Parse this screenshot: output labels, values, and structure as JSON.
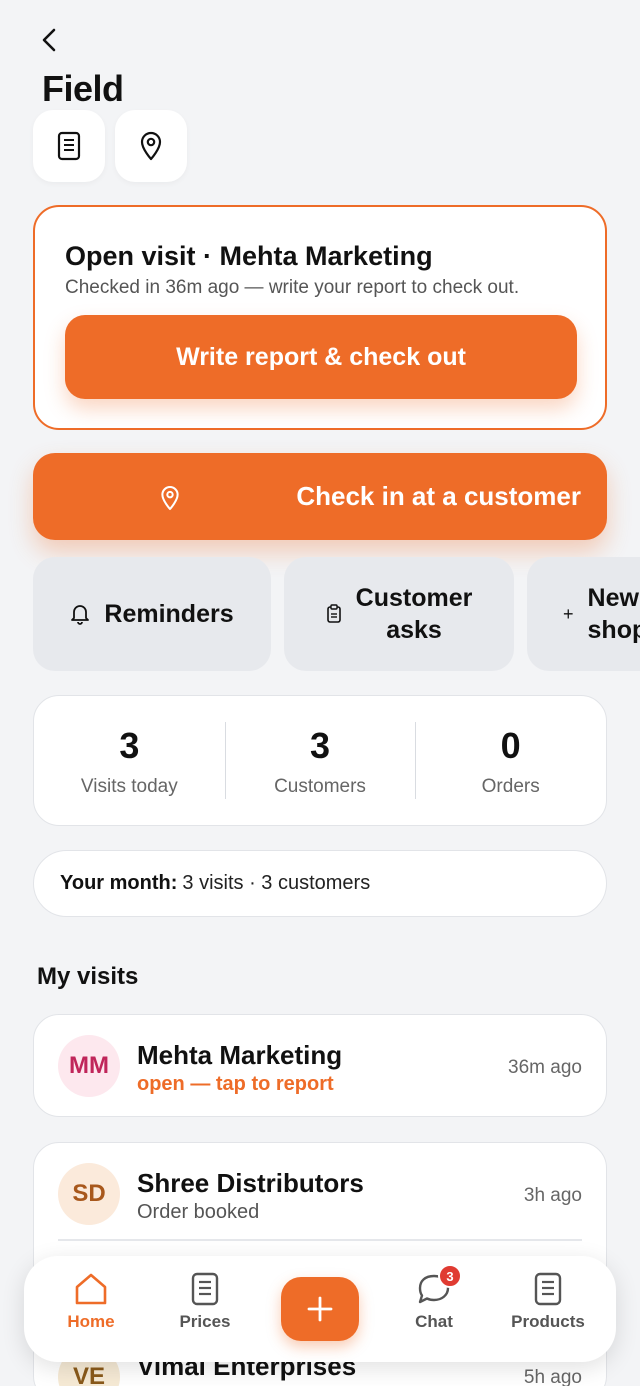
{
  "header": {
    "back_icon": "chevron-left-icon",
    "title": "Field",
    "actions": [
      {
        "icon": "document-icon"
      },
      {
        "icon": "map-pin-icon"
      }
    ]
  },
  "open_visit": {
    "title": "Open visit · Mehta Marketing",
    "subtitle": "Checked in 36m ago — write your report to check out.",
    "button_label": "Write report & check out"
  },
  "checkin": {
    "icon": "map-pin-icon",
    "label": "Check in at a customer"
  },
  "quick_actions": [
    {
      "icon": "bell-icon",
      "label": "Reminders"
    },
    {
      "icon": "clipboard-icon",
      "label_line1": "Customer",
      "label_line2": "asks"
    },
    {
      "icon": "plus-icon",
      "label_line1": "New",
      "label_line2": "shop"
    }
  ],
  "stats": [
    {
      "value": "3",
      "label": "Visits today"
    },
    {
      "value": "3",
      "label": "Customers"
    },
    {
      "value": "0",
      "label": "Orders"
    }
  ],
  "month_summary": {
    "label": "Your month:",
    "value": "3 visits · 3 customers"
  },
  "my_visits": {
    "title": "My visits",
    "items": [
      {
        "initials": "MM",
        "name": "Mehta Marketing",
        "status": "open — tap to report",
        "time": "36m ago",
        "avatar_bg": "#fde8ee",
        "avatar_fg": "#c0265a",
        "status_color": "#ee6c28"
      },
      {
        "initials": "SD",
        "name": "Shree Distributors",
        "status": "Order booked",
        "time": "3h ago",
        "avatar_bg": "#fbeadb",
        "avatar_fg": "#a8581c",
        "status_color": "#555555"
      },
      {
        "initials": "VE",
        "name": "Vimal Enterprises",
        "status": "",
        "time": "5h ago",
        "avatar_bg": "#f6ead5",
        "avatar_fg": "#8a5a1a",
        "status_color": "#555555"
      }
    ]
  },
  "bottom_nav": {
    "items": [
      {
        "icon": "home-icon",
        "label": "Home",
        "active": true
      },
      {
        "icon": "document-icon",
        "label": "Prices"
      },
      {
        "icon": "plus-icon",
        "label": ""
      },
      {
        "icon": "chat-icon",
        "label": "Chat",
        "badge": "3"
      },
      {
        "icon": "document-icon",
        "label": "Products"
      }
    ]
  },
  "colors": {
    "accent": "#ee6c28",
    "background": "#f3f4f6",
    "badge": "#e03b32"
  }
}
